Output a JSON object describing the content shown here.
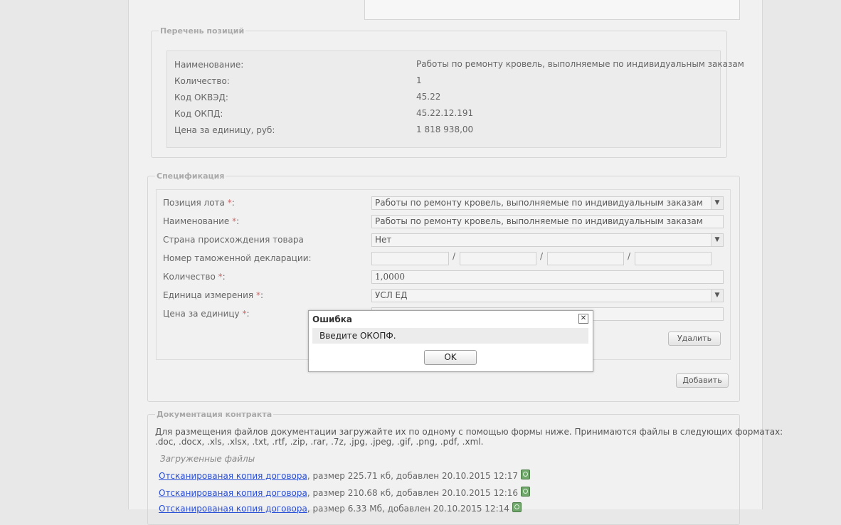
{
  "positions": {
    "legend": "Перечень позиций",
    "rows": [
      {
        "label": "Наименование:",
        "value": "Работы по ремонту кровель, выполняемые по индивидуальным заказам"
      },
      {
        "label": "Количество:",
        "value": "1"
      },
      {
        "label": "Код ОКВЭД:",
        "value": "45.22"
      },
      {
        "label": "Код ОКПД:",
        "value": "45.22.12.191"
      },
      {
        "label": "Цена за единицу, руб:",
        "value": "1 818 938,00"
      }
    ]
  },
  "spec": {
    "legend": "Спецификация",
    "lot_position_label": "Позиция лота",
    "lot_position_value": "Работы по ремонту кровель, выполняемые по индивидуальным заказам",
    "name_label": "Наименование",
    "name_value": "Работы по ремонту кровель, выполняемые по индивидуальным заказам",
    "country_label": "Страна происхождения товара",
    "country_value": "Нет",
    "customs_label": "Номер таможенной декларации:",
    "customs_sep": "/",
    "quantity_label": "Количество",
    "quantity_value": "1,0000",
    "unit_label": "Единица измерения",
    "unit_value": "УСЛ ЕД",
    "price_label": "Цена за единицу",
    "required_mark": "*",
    "colon": ":",
    "delete_button": "Удалить",
    "add_button": "Добавить"
  },
  "docs": {
    "legend": "Документация контракта",
    "info_line1": "Для размещения файлов документации загружайте их по одному с помощью формы ниже. Принимаются файлы в следующих форматах:",
    "info_line2": ".doc, .docx, .xls, .xlsx, .txt, .rtf, .zip, .rar, .7z, .jpg, .jpeg, .gif, .png, .pdf, .xml.",
    "uploaded_title": "Загруженные файлы",
    "files": [
      {
        "link": "Отсканированая копия договора",
        "meta": ", размер 225.71 кб, добавлен 20.10.2015 12:17"
      },
      {
        "link": "Отсканированая копия договора",
        "meta": ", размер 210.68 кб, добавлен 20.10.2015 12:16"
      },
      {
        "link": "Отсканированая копия договора",
        "meta": ", размер 6.33 Мб, добавлен 20.10.2015 12:14"
      }
    ]
  },
  "dialog": {
    "title": "Ошибка",
    "close": "✕",
    "message": "Введите ОКОПФ.",
    "ok": "OK"
  },
  "icons": {
    "select_arrow": "chevron-down-icon",
    "file_action": "recycle-icon",
    "close": "close-icon"
  }
}
